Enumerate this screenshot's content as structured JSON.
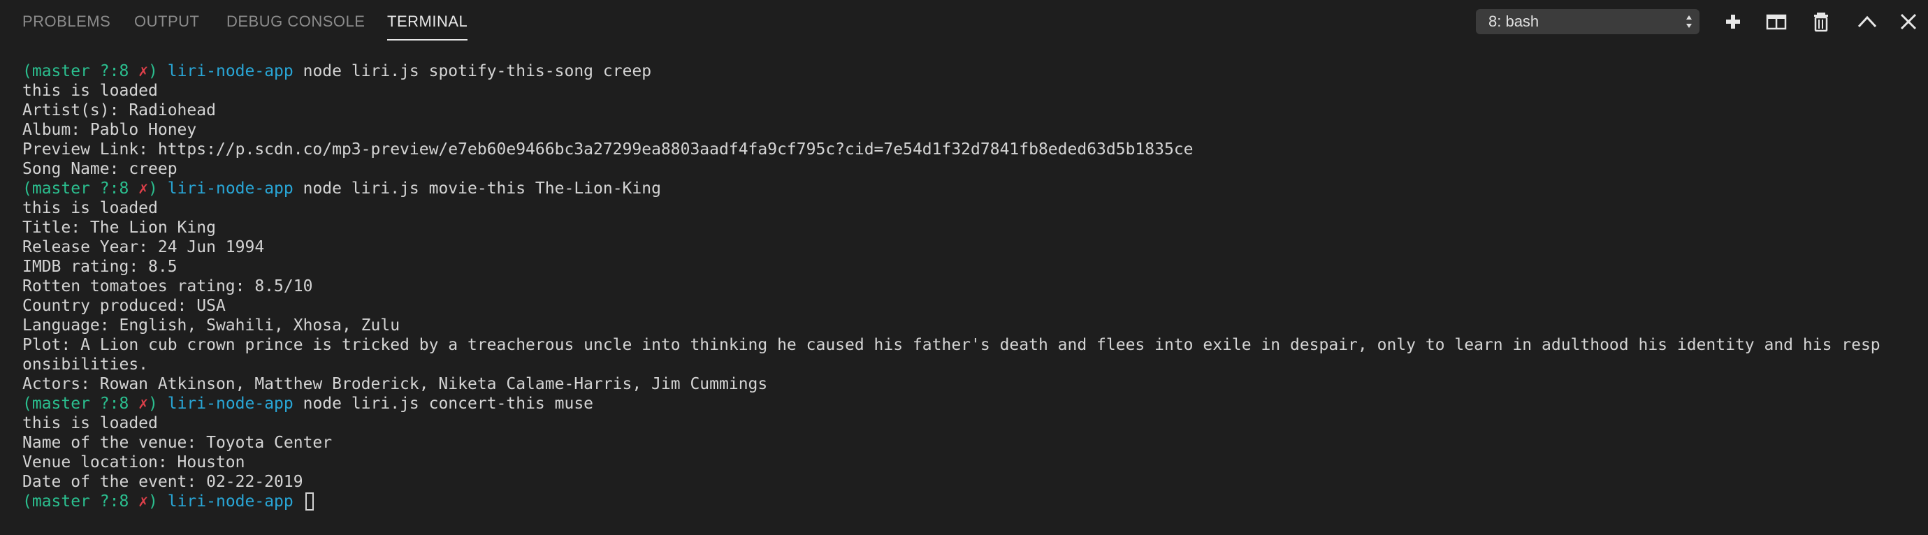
{
  "tabs": [
    {
      "label": "PROBLEMS",
      "active": false
    },
    {
      "label": "OUTPUT",
      "active": false
    },
    {
      "label": "DEBUG CONSOLE",
      "active": false
    },
    {
      "label": "TERMINAL",
      "active": true
    }
  ],
  "terminal_select": {
    "selected": "8: bash"
  },
  "actions": [
    {
      "icon": "plus-icon",
      "title": "New Terminal"
    },
    {
      "icon": "split-icon",
      "title": "Split Terminal"
    },
    {
      "icon": "trash-icon",
      "title": "Kill Terminal"
    },
    {
      "icon": "chevron-up-icon",
      "title": "Maximize Panel"
    },
    {
      "icon": "close-icon",
      "title": "Close Panel"
    }
  ],
  "prompt": {
    "branch": "(master ?:8 ",
    "mark": "✗",
    "close": ") ",
    "dir": "liri-node-app"
  },
  "terminal_lines": [
    {
      "type": "prompt",
      "command": " node liri.js spotify-this-song creep"
    },
    {
      "type": "output",
      "text": "this is loaded"
    },
    {
      "type": "output",
      "text": "Artist(s): Radiohead"
    },
    {
      "type": "output",
      "text": "Album: Pablo Honey"
    },
    {
      "type": "output",
      "text": "Preview Link: https://p.scdn.co/mp3-preview/e7eb60e9466bc3a27299ea8803aadf4fa9cf795c?cid=7e54d1f32d7841fb8eded63d5b1835ce"
    },
    {
      "type": "output",
      "text": "Song Name: creep"
    },
    {
      "type": "prompt",
      "command": " node liri.js movie-this The-Lion-King"
    },
    {
      "type": "output",
      "text": "this is loaded"
    },
    {
      "type": "output",
      "text": "Title: The Lion King"
    },
    {
      "type": "output",
      "text": "Release Year: 24 Jun 1994"
    },
    {
      "type": "output",
      "text": "IMDB rating: 8.5"
    },
    {
      "type": "output",
      "text": "Rotten tomatoes rating: 8.5/10"
    },
    {
      "type": "output",
      "text": "Country produced: USA"
    },
    {
      "type": "output",
      "text": "Language: English, Swahili, Xhosa, Zulu"
    },
    {
      "type": "output",
      "text": "Plot: A Lion cub crown prince is tricked by a treacherous uncle into thinking he caused his father's death and flees into exile in despair, only to learn in adulthood his identity and his resp"
    },
    {
      "type": "output",
      "text": "onsibilities."
    },
    {
      "type": "output",
      "text": "Actors: Rowan Atkinson, Matthew Broderick, Niketa Calame-Harris, Jim Cummings"
    },
    {
      "type": "prompt",
      "command": " node liri.js concert-this muse"
    },
    {
      "type": "output",
      "text": "this is loaded"
    },
    {
      "type": "output",
      "text": "Name of the venue: Toyota Center"
    },
    {
      "type": "output",
      "text": "Venue location: Houston"
    },
    {
      "type": "output",
      "text": "Date of the event: 02-22-2019"
    },
    {
      "type": "prompt",
      "command": " ",
      "cursor": true
    }
  ]
}
